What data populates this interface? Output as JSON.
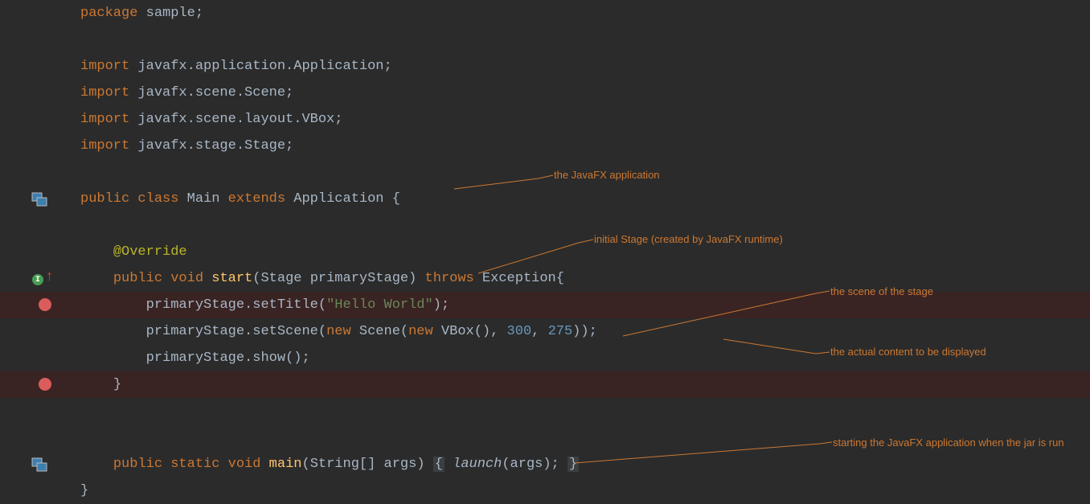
{
  "code": {
    "l1_kw": "package",
    "l1_rest": " sample;",
    "l3_kw": "import",
    "l3_rest": " javafx.application.Application;",
    "l4_kw": "import",
    "l4_rest": " javafx.scene.Scene;",
    "l5_kw": "import",
    "l5_rest": " javafx.scene.layout.VBox;",
    "l6_kw": "import",
    "l6_rest": " javafx.stage.Stage;",
    "l8_public": "public",
    "l8_class": " class",
    "l8_name": " Main",
    "l8_extends": " extends",
    "l8_super": " Application ",
    "l8_brace": "{",
    "l10_anno": "@Override",
    "l11_public": "public",
    "l11_void": " void",
    "l11_method": " start",
    "l11_lp": "(",
    "l11_ptype": "Stage ",
    "l11_pname": "primaryStage",
    "l11_rp": ")",
    "l11_throws": " throws",
    "l11_exc": " Exception",
    "l11_brace": "{",
    "l12_obj": "primaryStage",
    "l12_dot": ".",
    "l12_m": "setTitle",
    "l12_lp": "(",
    "l12_str": "\"Hello World\"",
    "l12_rp": ");",
    "l13_obj": "primaryStage",
    "l13_dot": ".",
    "l13_m": "setScene",
    "l13_lp": "(",
    "l13_new1": "new",
    "l13_scene": " Scene(",
    "l13_new2": "new",
    "l13_vbox": " VBox(), ",
    "l13_n1": "300",
    "l13_c": ", ",
    "l13_n2": "275",
    "l13_rp": "));",
    "l14_obj": "primaryStage",
    "l14_dot": ".",
    "l14_m": "show",
    "l14_rp": "();",
    "l15_brace": "}",
    "l18_public": "public",
    "l18_static": " static",
    "l18_void": " void",
    "l18_main": " main",
    "l18_lp": "(",
    "l18_args": "String[] args",
    "l18_rp": ") ",
    "l18_ob": "{",
    "l18_launch": " launch",
    "l18_largs": "(args); ",
    "l18_cb": "}",
    "l19_brace": "}"
  },
  "annotations": {
    "a1": "the JavaFX application",
    "a2": "initial Stage (created by JavaFX runtime)",
    "a3": "the scene of the stage",
    "a4": "the actual content to be displayed",
    "a5": "starting the JavaFX application when the jar is run"
  }
}
